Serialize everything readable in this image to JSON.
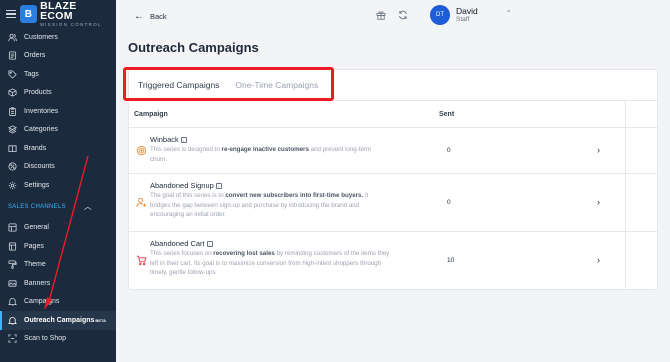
{
  "brand": {
    "title": "BLAZE ECOM",
    "subtitle": "MISSION CONTROL",
    "mark": "B"
  },
  "sidebar": {
    "items": [
      {
        "label": "Customers",
        "icon": "users-icon"
      },
      {
        "label": "Orders",
        "icon": "orders-icon"
      },
      {
        "label": "Tags",
        "icon": "tag-icon"
      },
      {
        "label": "Products",
        "icon": "box-icon"
      },
      {
        "label": "Inventories",
        "icon": "clipboard-icon"
      },
      {
        "label": "Categories",
        "icon": "layers-icon"
      },
      {
        "label": "Brands",
        "icon": "book-icon"
      },
      {
        "label": "Discounts",
        "icon": "discount-icon"
      },
      {
        "label": "Settings",
        "icon": "gear-icon"
      }
    ],
    "section_label": "SALES CHANNELS",
    "channel_items": [
      {
        "label": "General",
        "icon": "grid-icon"
      },
      {
        "label": "Pages",
        "icon": "page-icon"
      },
      {
        "label": "Theme",
        "icon": "paint-icon"
      },
      {
        "label": "Banners",
        "icon": "banner-icon"
      },
      {
        "label": "Campaigns",
        "icon": "bell-icon"
      }
    ],
    "active_item": {
      "label": "Outreach Campaigns",
      "badge": "BETA"
    },
    "last_item": {
      "label": "Scan to Shop"
    }
  },
  "topbar": {
    "back_label": "Back",
    "user": {
      "initials": "DT",
      "name": "David",
      "role": "Staff"
    }
  },
  "page": {
    "title": "Outreach Campaigns"
  },
  "tabs": [
    {
      "label": "Triggered Campaigns",
      "active": true
    },
    {
      "label": "One-Time Campaigns",
      "active": false
    }
  ],
  "table": {
    "columns": {
      "campaign": "Campaign",
      "sent": "Sent"
    },
    "rows": [
      {
        "name": "Winback",
        "desc_pre": "This series is designed to ",
        "desc_bold": "re-engage inactive customers",
        "desc_post": " and prevent long-term churn.",
        "sent": "0"
      },
      {
        "name": "Abandoned Signup",
        "desc_pre": "The goal of this series is to ",
        "desc_bold": "convert new subscribers into first-time buyers.",
        "desc_post": " It bridges the gap between sign-up and purchase by introducing the brand and encouraging an initial order.",
        "sent": "0"
      },
      {
        "name": "Abandoned Cart",
        "desc_pre": "This series focuses on ",
        "desc_bold": "recovering lost sales",
        "desc_post": " by reminding customers of the items they left in their cart. Its goal is to maximize conversion from high-intent shoppers through timely, gentle follow-ups",
        "sent": "10"
      }
    ]
  },
  "colors": {
    "sidebar_bg": "#1b2a3d",
    "accent": "#38b6ff",
    "highlight": "#ee1b24",
    "avatar": "#1e5bd6",
    "row_icon": "#e8893a"
  }
}
